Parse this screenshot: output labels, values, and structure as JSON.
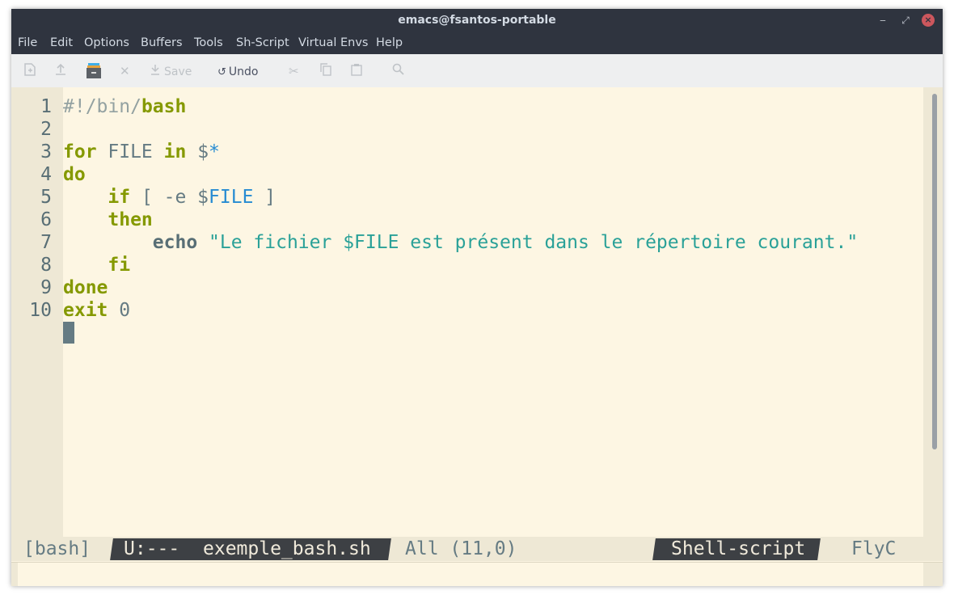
{
  "window": {
    "title": "emacs@fsantos-portable"
  },
  "menubar": {
    "items": [
      "File",
      "Edit",
      "Options",
      "Buffers",
      "Tools",
      "Sh-Script",
      "Virtual Envs",
      "Help"
    ]
  },
  "toolbar": {
    "save_label": "Save",
    "undo_label": "Undo"
  },
  "editor": {
    "line_numbers": [
      "1",
      "2",
      "3",
      "4",
      "5",
      "6",
      "7",
      "8",
      "9",
      "10"
    ],
    "lines": [
      [
        {
          "t": "#!/bin/",
          "c": "cmt"
        },
        {
          "t": "bash",
          "c": "kw"
        }
      ],
      [],
      [
        {
          "t": "for",
          "c": "kw"
        },
        {
          "t": " FILE ",
          "c": ""
        },
        {
          "t": "in",
          "c": "kw"
        },
        {
          "t": " $",
          "c": ""
        },
        {
          "t": "*",
          "c": "var"
        }
      ],
      [
        {
          "t": "do",
          "c": "kw"
        }
      ],
      [
        {
          "t": "    ",
          "c": ""
        },
        {
          "t": "if",
          "c": "kw"
        },
        {
          "t": " [ -e $",
          "c": ""
        },
        {
          "t": "FILE",
          "c": "var"
        },
        {
          "t": " ]",
          "c": ""
        }
      ],
      [
        {
          "t": "    ",
          "c": ""
        },
        {
          "t": "then",
          "c": "kw"
        }
      ],
      [
        {
          "t": "        ",
          "c": ""
        },
        {
          "t": "echo",
          "c": "bi"
        },
        {
          "t": " ",
          "c": ""
        },
        {
          "t": "\"Le fichier $FILE est présent dans le répertoire courant.\"",
          "c": "str"
        }
      ],
      [
        {
          "t": "    ",
          "c": ""
        },
        {
          "t": "fi",
          "c": "kw"
        }
      ],
      [
        {
          "t": "done",
          "c": "kw"
        }
      ],
      [
        {
          "t": "exit",
          "c": "kw"
        },
        {
          "t": " 0",
          "c": ""
        }
      ]
    ],
    "cursor_position": "11,0"
  },
  "modeline": {
    "env": "[bash]",
    "status": "U:---",
    "buffer_name": "exemple_bash.sh",
    "position": "All (11,0)",
    "major_mode": "Shell-script",
    "minor_mode": "FlyC"
  },
  "colors": {
    "background": "#fdf6e3",
    "keyword": "#859900",
    "variable": "#268bd2",
    "string": "#2aa198",
    "titlebar": "#2f343f"
  }
}
